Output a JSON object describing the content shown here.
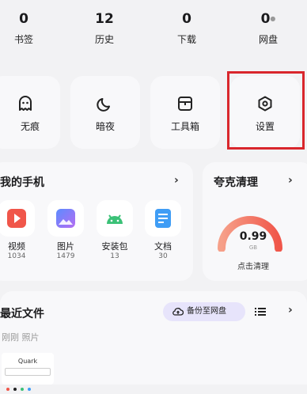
{
  "stats": [
    {
      "value": "0",
      "label": "书签"
    },
    {
      "value": "12",
      "label": "历史"
    },
    {
      "value": "0",
      "label": "下载"
    },
    {
      "value": "0",
      "label": "网盘"
    }
  ],
  "quick_actions": [
    {
      "label": "无痕",
      "icon": "ghost-icon"
    },
    {
      "label": "暗夜",
      "icon": "moon-icon"
    },
    {
      "label": "工具箱",
      "icon": "toolbox-icon"
    },
    {
      "label": "设置",
      "icon": "hexagon-gear-icon"
    }
  ],
  "my_phone": {
    "title": "我的手机",
    "items": [
      {
        "name": "视频",
        "count": "1034",
        "color": "#f0564a"
      },
      {
        "name": "图片",
        "count": "1479",
        "color": "#6f7cf4"
      },
      {
        "name": "安装包",
        "count": "13",
        "color": "#3bc177"
      },
      {
        "name": "文档",
        "count": "30",
        "color": "#3f9df5"
      }
    ]
  },
  "cleaner": {
    "title": "夸克清理",
    "value": "0.99",
    "unit": "GB",
    "action": "点击清理"
  },
  "recent": {
    "title": "最近文件",
    "backup_label": "备份至网盘",
    "sub_tabs": "刚刚  照片",
    "thumb_text": "Quark"
  },
  "colors": {
    "highlight": "#d9262c",
    "accent": "#f27a5a"
  }
}
